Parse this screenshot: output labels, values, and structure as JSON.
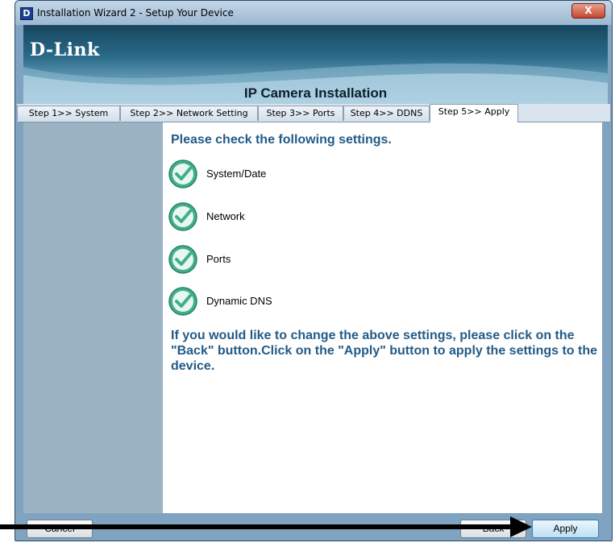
{
  "window": {
    "title": "Installation Wizard 2 - Setup Your Device",
    "app_icon_letter": "D",
    "close_glyph": "X"
  },
  "banner": {
    "logo": "D-Link",
    "title": "IP Camera Installation"
  },
  "tabs": [
    {
      "label": "Step 1>> System",
      "active": false
    },
    {
      "label": "Step 2>> Network Setting",
      "active": false
    },
    {
      "label": "Step 3>> Ports",
      "active": false
    },
    {
      "label": "Step 4>> DDNS",
      "active": false
    },
    {
      "label": "Step 5>> Apply",
      "active": true
    }
  ],
  "main": {
    "heading": "Please check the following settings.",
    "checks": [
      {
        "label": "System/Date",
        "icon": "checkmark-icon"
      },
      {
        "label": "Network",
        "icon": "checkmark-icon"
      },
      {
        "label": "Ports",
        "icon": "checkmark-icon"
      },
      {
        "label": "Dynamic DNS",
        "icon": "checkmark-icon"
      }
    ],
    "note": "If you would like to change the above settings, please click on the \"Back\" button.Click on the \"Apply\" button to apply the settings to the device."
  },
  "buttons": {
    "cancel": "Cancel",
    "back": "Back",
    "apply": "Apply"
  },
  "colors": {
    "accent_text": "#235b86",
    "check_green": "#3fae8b",
    "panel_blue": "#9cb3c4"
  }
}
